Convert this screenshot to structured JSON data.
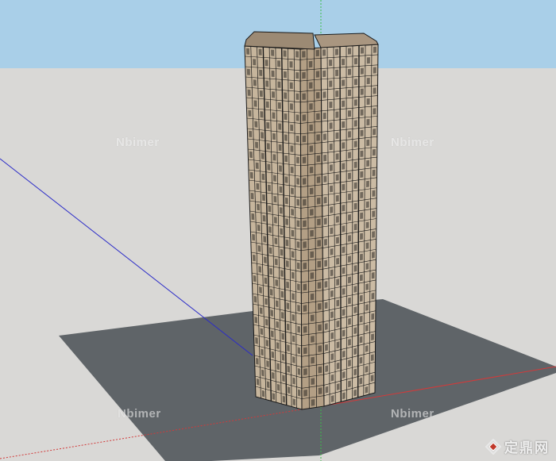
{
  "colors": {
    "sky": "#a9cfe8",
    "ground": "#d9d8d6",
    "slab": "#5f6468",
    "facade_light": "#c9b9a2",
    "facade_shadow": "#a8957d",
    "facade_line": "#1a1a1a",
    "axis_red": "#d23a3a",
    "axis_blue": "#2b2bc8",
    "axis_green": "#3bbd4a"
  },
  "watermarks": [
    {
      "text": "Nbimer"
    },
    {
      "text": "Nbimer"
    },
    {
      "text": "Nbimer"
    },
    {
      "text": "Nbimer"
    }
  ],
  "logo": {
    "icon": "diamond-logo-icon",
    "text": "定鼎网"
  }
}
